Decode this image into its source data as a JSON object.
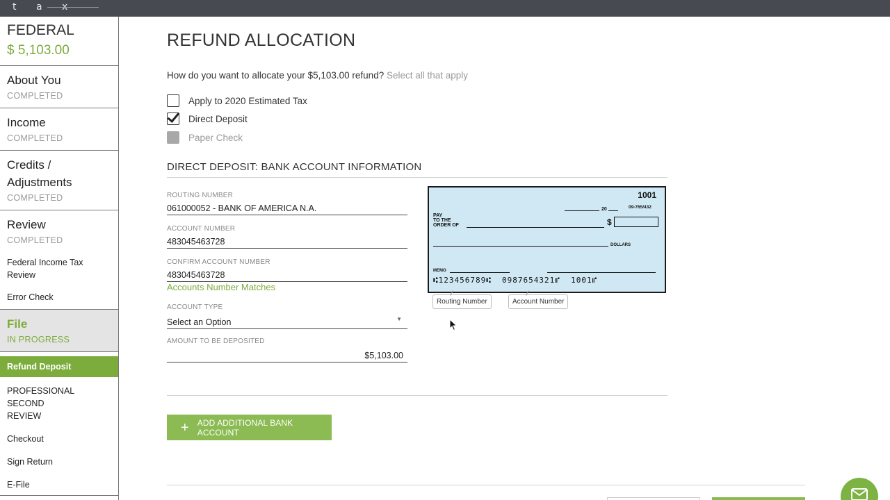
{
  "brand": {
    "logo_text": "t a x"
  },
  "sidebar": {
    "federal_title": "FEDERAL",
    "federal_amount": "$ 5,103.00",
    "steps": [
      {
        "title": "About You",
        "status": "COMPLETED"
      },
      {
        "title": "Income",
        "status": "COMPLETED"
      },
      {
        "title": "Credits / Adjustments",
        "status": "COMPLETED"
      },
      {
        "title": "Review",
        "status": "COMPLETED",
        "sub_items": [
          "Federal Income Tax Review",
          "Error Check"
        ]
      },
      {
        "title": "File",
        "status": "IN PROGRESS"
      }
    ],
    "file_items": [
      "Refund Deposit",
      "PROFESSIONAL SECOND REVIEW",
      "Checkout",
      "Sign Return",
      "E-File"
    ]
  },
  "main": {
    "title": "REFUND ALLOCATION",
    "question": "How do you want to allocate your $5,103.00 refund?",
    "question_hint": "Select all that apply",
    "options": [
      {
        "label": "Apply to 2020 Estimated Tax",
        "checked": false,
        "disabled": false
      },
      {
        "label": "Direct Deposit",
        "checked": true,
        "disabled": false
      },
      {
        "label": "Paper Check",
        "checked": false,
        "disabled": true
      }
    ],
    "section_title": "DIRECT DEPOSIT: BANK ACCOUNT INFORMATION",
    "fields": {
      "routing": {
        "label": "ROUTING NUMBER",
        "value": "061000052 - BANK OF AMERICA N.A."
      },
      "account": {
        "label": "ACCOUNT NUMBER",
        "value": "483045463728"
      },
      "confirm": {
        "label": "CONFIRM ACCOUNT NUMBER",
        "value": "483045463728"
      },
      "account_type": {
        "label": "ACCOUNT TYPE",
        "value": "Select an Option"
      },
      "amount": {
        "label": "AMOUNT TO BE DEPOSITED",
        "value": "$5,103.00"
      }
    },
    "match_message": "Accounts Number Matches",
    "check": {
      "number": "1001",
      "date_suffix": "20",
      "fraction": "09-765/432",
      "pay_line1": "PAY",
      "pay_line2": "TO THE",
      "pay_line3": "ORDER OF",
      "dollar_sign": "$",
      "dollars": "DOLLARS",
      "memo": "MEMO",
      "micr": "⑆123456789⑆  0987654321⑈  1001⑈"
    },
    "check_labels": {
      "routing": "Routing Number",
      "account": "Account Number"
    },
    "add_button": {
      "icon": "+",
      "label": "ADD ADDITIONAL BANK ACCOUNT"
    }
  },
  "colors": {
    "accent": "#7cac3c",
    "button": "#8bbb52",
    "topbar": "#474a51",
    "check_bg": "#cfe8f3"
  },
  "icons": {
    "fab": "mail-icon",
    "cursor": "pointer-cursor-icon"
  }
}
